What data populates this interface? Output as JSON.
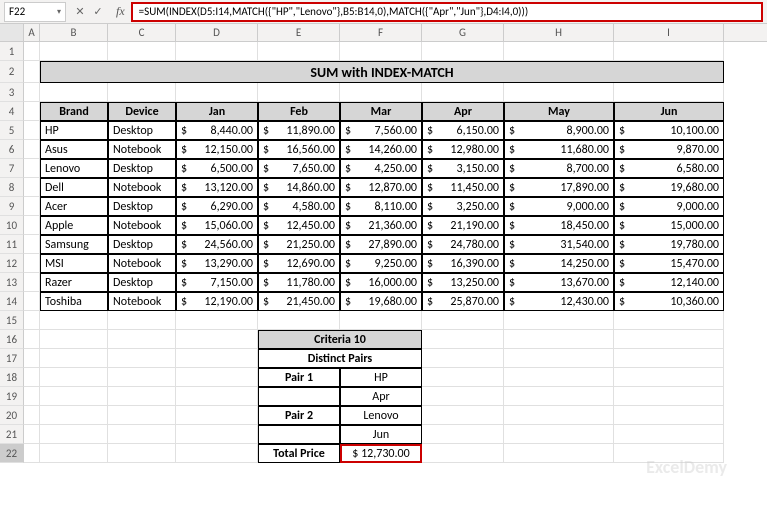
{
  "cell_ref": "F22",
  "formula": "=SUM(INDEX(D5:I14,MATCH({\"HP\",\"Lenovo\"},B5:B14,0),MATCH({\"Apr\",\"Jun\"},D4:I4,0)))",
  "columns": [
    "A",
    "B",
    "C",
    "D",
    "E",
    "F",
    "G",
    "H",
    "I"
  ],
  "title": "SUM with INDEX-MATCH",
  "headers": {
    "brand": "Brand",
    "device": "Device",
    "jan": "Jan",
    "feb": "Feb",
    "mar": "Mar",
    "apr": "Apr",
    "may": "May",
    "jun": "Jun"
  },
  "rows": [
    {
      "brand": "HP",
      "device": "Desktop",
      "jan": "8,440.00",
      "feb": "11,890.00",
      "mar": "7,560.00",
      "apr": "6,150.00",
      "may": "8,900.00",
      "jun": "10,100.00"
    },
    {
      "brand": "Asus",
      "device": "Notebook",
      "jan": "12,150.00",
      "feb": "16,560.00",
      "mar": "14,260.00",
      "apr": "12,980.00",
      "may": "11,680.00",
      "jun": "9,870.00"
    },
    {
      "brand": "Lenovo",
      "device": "Desktop",
      "jan": "6,500.00",
      "feb": "7,650.00",
      "mar": "4,250.00",
      "apr": "3,150.00",
      "may": "8,700.00",
      "jun": "6,580.00"
    },
    {
      "brand": "Dell",
      "device": "Notebook",
      "jan": "13,120.00",
      "feb": "14,860.00",
      "mar": "12,870.00",
      "apr": "11,450.00",
      "may": "17,890.00",
      "jun": "19,680.00"
    },
    {
      "brand": "Acer",
      "device": "Desktop",
      "jan": "6,290.00",
      "feb": "4,580.00",
      "mar": "8,110.00",
      "apr": "3,250.00",
      "may": "9,000.00",
      "jun": "9,000.00"
    },
    {
      "brand": "Apple",
      "device": "Notebook",
      "jan": "15,060.00",
      "feb": "12,450.00",
      "mar": "21,360.00",
      "apr": "21,190.00",
      "may": "18,450.00",
      "jun": "15,000.00"
    },
    {
      "brand": "Samsung",
      "device": "Desktop",
      "jan": "24,560.00",
      "feb": "21,250.00",
      "mar": "27,890.00",
      "apr": "24,780.00",
      "may": "31,540.00",
      "jun": "19,780.00"
    },
    {
      "brand": "MSI",
      "device": "Notebook",
      "jan": "13,290.00",
      "feb": "12,690.00",
      "mar": "9,250.00",
      "apr": "16,390.00",
      "may": "14,250.00",
      "jun": "15,470.00"
    },
    {
      "brand": "Razer",
      "device": "Desktop",
      "jan": "7,150.00",
      "feb": "11,780.00",
      "mar": "16,000.00",
      "apr": "13,250.00",
      "may": "13,670.00",
      "jun": "12,140.00"
    },
    {
      "brand": "Toshiba",
      "device": "Notebook",
      "jan": "12,190.00",
      "feb": "21,450.00",
      "mar": "19,680.00",
      "apr": "25,870.00",
      "may": "12,430.00",
      "jun": "10,360.00"
    }
  ],
  "criteria": {
    "title": "Criteria 10",
    "subtitle": "Distinct Pairs",
    "pair1_label": "Pair 1",
    "pair1_v1": "HP",
    "pair1_v2": "Apr",
    "pair2_label": "Pair 2",
    "pair2_v1": "Lenovo",
    "pair2_v2": "Jun",
    "total_label": "Total Price",
    "total_value": "$   12,730.00"
  },
  "watermark": "ExcelDemy"
}
